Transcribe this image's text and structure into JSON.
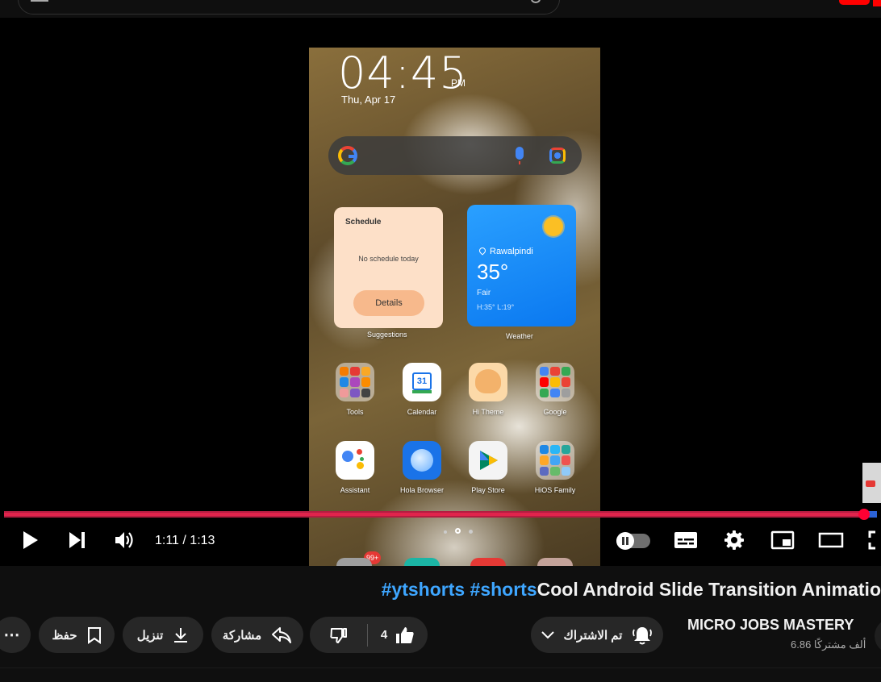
{
  "player": {
    "time_current": "1:11",
    "time_total": "1:13",
    "time_display": "1:11 / 1:13",
    "progress_fraction": 0.985
  },
  "phone": {
    "clock": "04:45",
    "clock_period": "PM",
    "date": "Thu, Apr 17",
    "schedule": {
      "title": "Schedule",
      "empty_text": "No schedule today",
      "button": "Details",
      "caption": "Suggestions"
    },
    "weather": {
      "city": "Rawalpindi",
      "temp": "35°",
      "condition": "Fair",
      "range": "H:35° L:19°",
      "caption": "Weather"
    },
    "apps_row1": [
      "Tools",
      "Calendar",
      "Hi Theme",
      "Google"
    ],
    "apps_row2": [
      "Assistant",
      "Hola Browser",
      "Play Store",
      "HiOS Family"
    ],
    "calendar_day": "31",
    "dock_badge": "99+"
  },
  "video": {
    "hashtag1": "#ytshorts",
    "hashtag2": "#shorts",
    "title_text": "Cool Android Slide Transition Animatio"
  },
  "channel": {
    "name": "MICRO JOBS MASTERY",
    "subscribers": "6.86 ألف مشتركًا",
    "subscribed_label": "تم الاشتراك"
  },
  "actions": {
    "like_count": "4",
    "share_label": "مشاركة",
    "download_label": "تنزيل",
    "save_label": "حفظ",
    "more_label": "⋯"
  },
  "colors": {
    "progress_played": "#e0244c",
    "progress_track": "#2b62d6",
    "hashtag": "#3ea6ff",
    "pill_bg": "#272727"
  }
}
